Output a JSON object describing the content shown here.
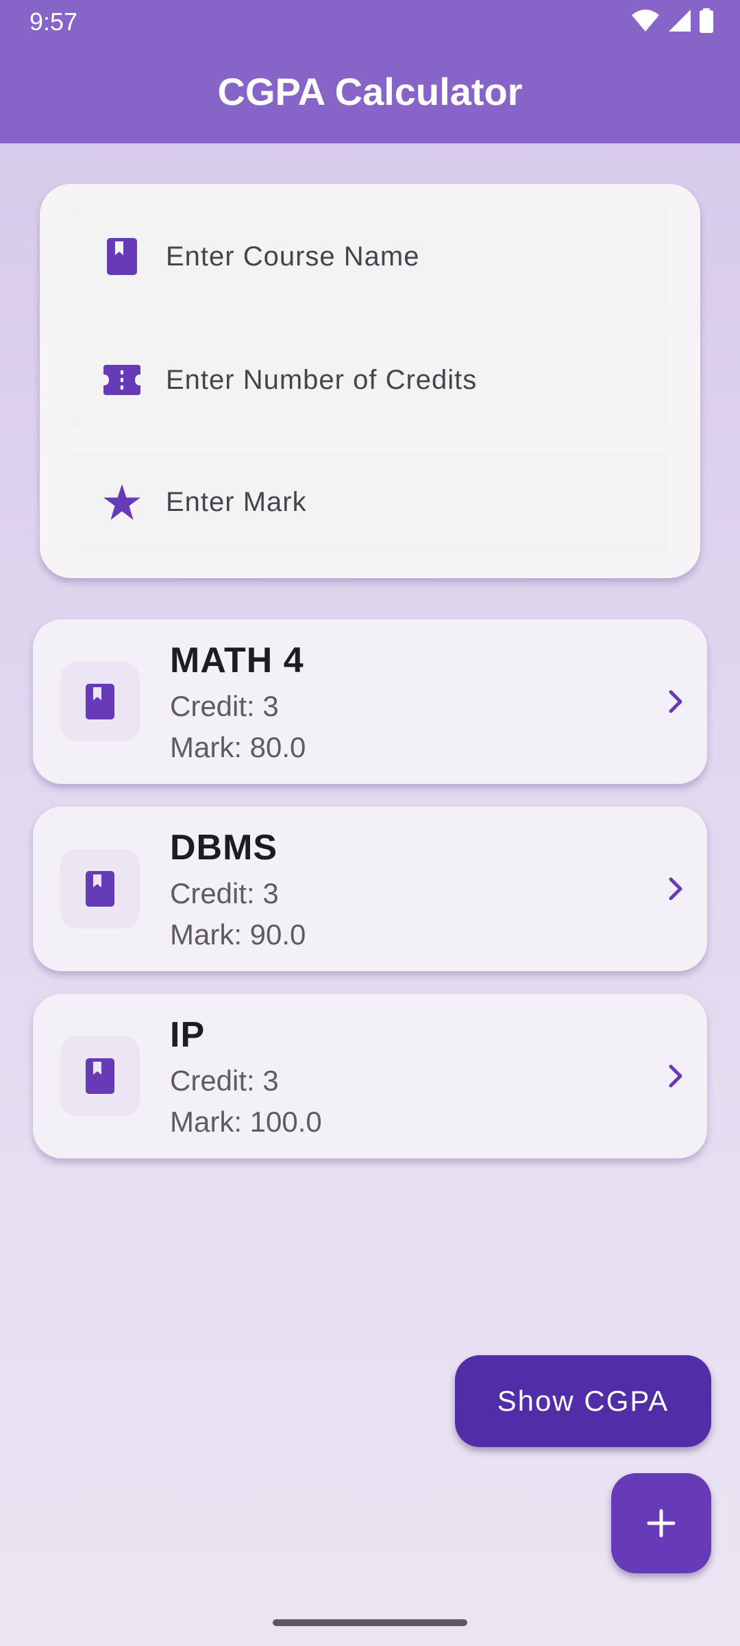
{
  "status_bar": {
    "time": "9:57",
    "icons": [
      "wifi-icon",
      "signal-icon",
      "battery-icon"
    ]
  },
  "app_bar": {
    "title": "CGPA Calculator"
  },
  "form": {
    "course_name_placeholder": "Enter Course Name",
    "credits_placeholder": "Enter Number of Credits",
    "mark_placeholder": "Enter Mark",
    "icons": [
      "book-icon",
      "ticket-icon",
      "star-icon"
    ]
  },
  "courses": [
    {
      "name": "MATH 4",
      "credit": "Credit: 3",
      "mark": "Mark: 80.0"
    },
    {
      "name": "DBMS",
      "credit": "Credit: 3",
      "mark": "Mark: 90.0"
    },
    {
      "name": "IP",
      "credit": "Credit: 3",
      "mark": "Mark: 100.0"
    }
  ],
  "actions": {
    "show_cgpa_label": "Show CGPA",
    "add_icon": "plus-icon"
  },
  "colors": {
    "app_bar": "#8765c8",
    "accent": "#673ab7",
    "button": "#512da8"
  }
}
